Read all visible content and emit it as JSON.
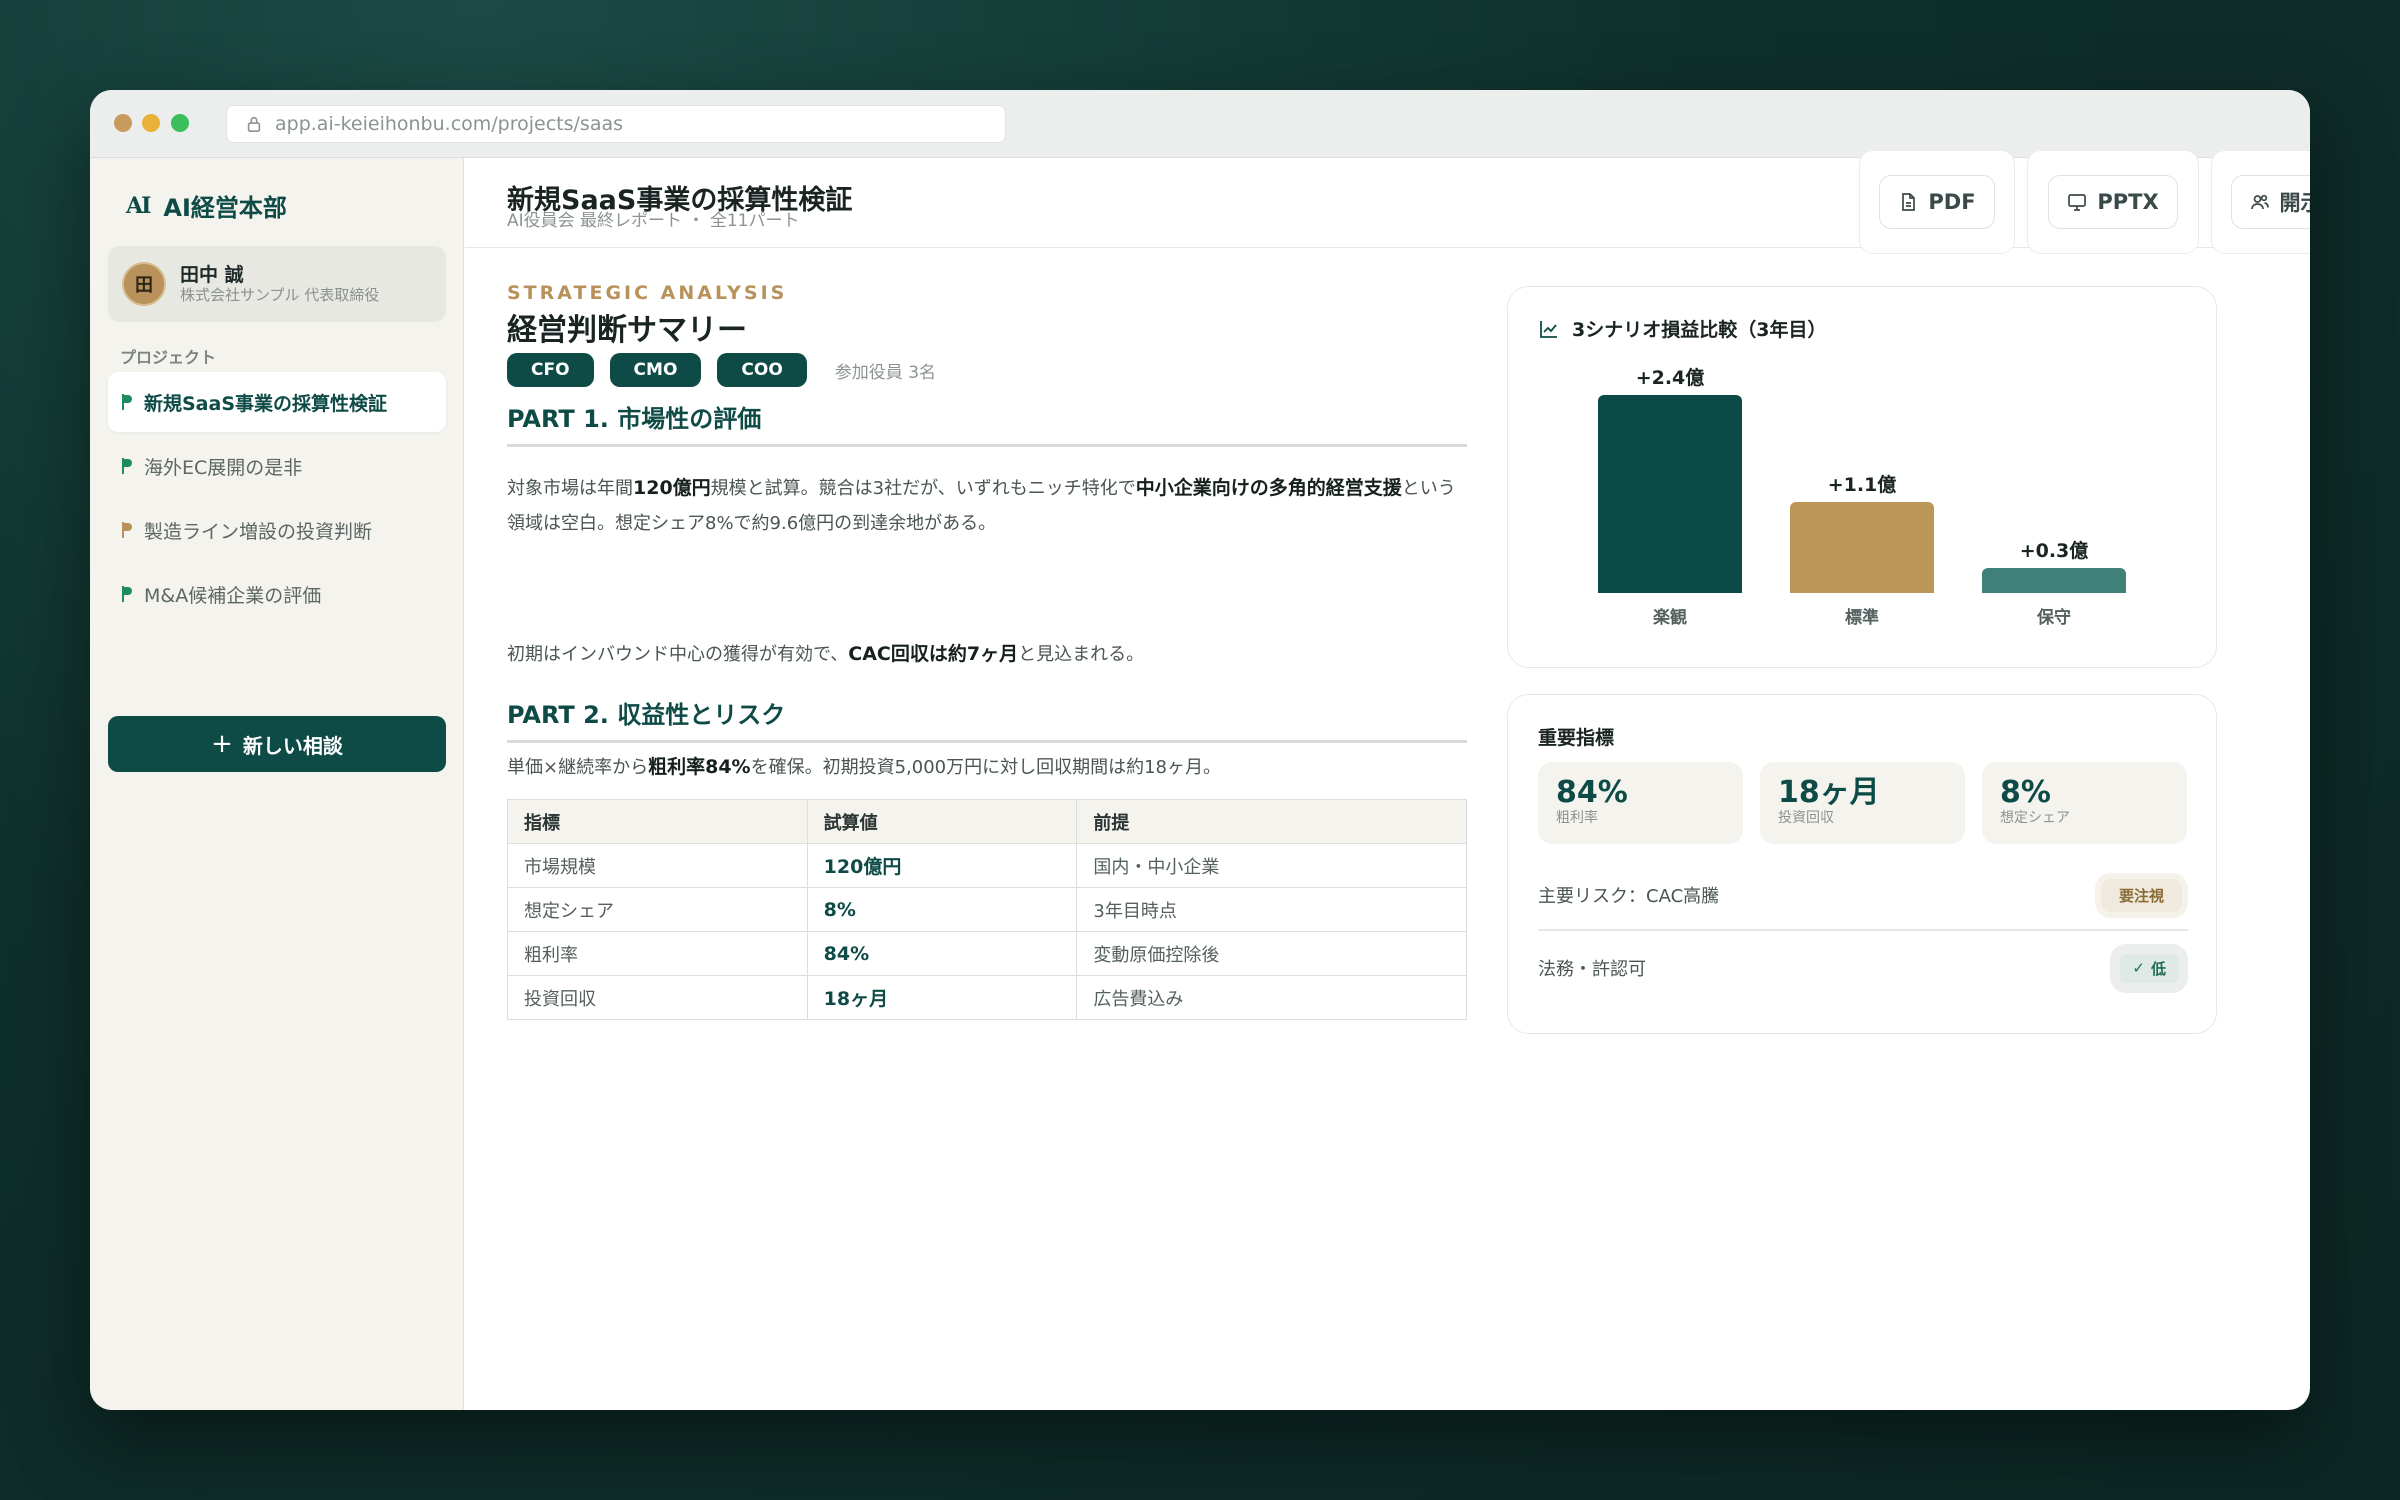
{
  "browser": {
    "url": "app.ai-keieihonbu.com/projects/saas"
  },
  "brand": {
    "logo": "AI",
    "name": "AI経営本部"
  },
  "user": {
    "initial": "田",
    "name": "田中 誠",
    "role": "株式会社サンプル 代表取締役"
  },
  "sidebar": {
    "section_label": "プロジェクト",
    "items": [
      {
        "label": "新規SaaS事業の採算性検証",
        "active": true,
        "flag": "green"
      },
      {
        "label": "海外EC展開の是非",
        "active": false,
        "flag": "green"
      },
      {
        "label": "製造ライン増設の投資判断",
        "active": false,
        "flag": "orange"
      },
      {
        "label": "M&A候補企業の評価",
        "active": false,
        "flag": "green"
      }
    ],
    "new_button": "新しい相談"
  },
  "header": {
    "title": "新規SaaS事業の採算性検証",
    "subtitle": "AI役員会 最終レポート ・ 全11パート",
    "buttons": {
      "pdf": "PDF",
      "pptx": "PPTX",
      "disclosure": "開示用"
    }
  },
  "report": {
    "eyebrow": "STRATEGIC ANALYSIS",
    "title": "経営判断サマリー",
    "tags": [
      "CFO",
      "CMO",
      "COO"
    ],
    "participants": "参加役員 3名",
    "part1": {
      "heading": "PART 1. 市場性の評価",
      "p1": {
        "t1": "対象市場は年間",
        "b1": "120億円",
        "t2": "規模と試算。競合は3社だが、いずれもニッチ特化で",
        "b2": "中小企業向けの多角的経営支援",
        "t3": "という領域は空白。想定シェア8%で約9.6億円の到達余地がある。"
      },
      "p2": {
        "t1": "初期はインバウンド中心の獲得が有効で、",
        "b1": "CAC回収は約7ヶ月",
        "t2": "と見込まれる。"
      }
    },
    "part2": {
      "heading": "PART 2. 収益性とリスク",
      "p1": {
        "t1": "単価×継続率から",
        "b1": "粗利率84%",
        "t2": "を確保。初期投資5,000万円に対し回収期間は約18ヶ月。"
      }
    },
    "table": {
      "headers": [
        "指標",
        "試算値",
        "前提"
      ],
      "rows": [
        [
          "市場規模",
          "120億円",
          "国内・中小企業"
        ],
        [
          "想定シェア",
          "8%",
          "3年目時点"
        ],
        [
          "粗利率",
          "84%",
          "変動原価控除後"
        ],
        [
          "投資回収",
          "18ヶ月",
          "広告費込み"
        ]
      ]
    }
  },
  "chart_card": {
    "title": "3シナリオ損益比較（3年目）",
    "icon": "line-chart-icon"
  },
  "chart_data": {
    "type": "bar",
    "title": "3シナリオ損益比較（3年目）",
    "categories": [
      "楽観",
      "標準",
      "保守"
    ],
    "values": [
      2.4,
      1.1,
      0.3
    ],
    "value_labels": [
      "+2.4億",
      "+1.1億",
      "+0.3億"
    ],
    "colors": [
      "#0c4a47",
      "#bc9758",
      "#3f8079"
    ],
    "unit": "億",
    "ylim": [
      0,
      2.4
    ],
    "grid": false
  },
  "kpi_card": {
    "title": "重要指標",
    "kpis": [
      {
        "value": "84%",
        "label": "粗利率"
      },
      {
        "value": "18ヶ月",
        "label": "投資回収"
      },
      {
        "value": "8%",
        "label": "想定シェア"
      }
    ],
    "risks": [
      {
        "label": "主要リスク：CAC高騰",
        "badge": "要注視"
      },
      {
        "label": "法務・許認可",
        "badge": "低"
      }
    ]
  }
}
